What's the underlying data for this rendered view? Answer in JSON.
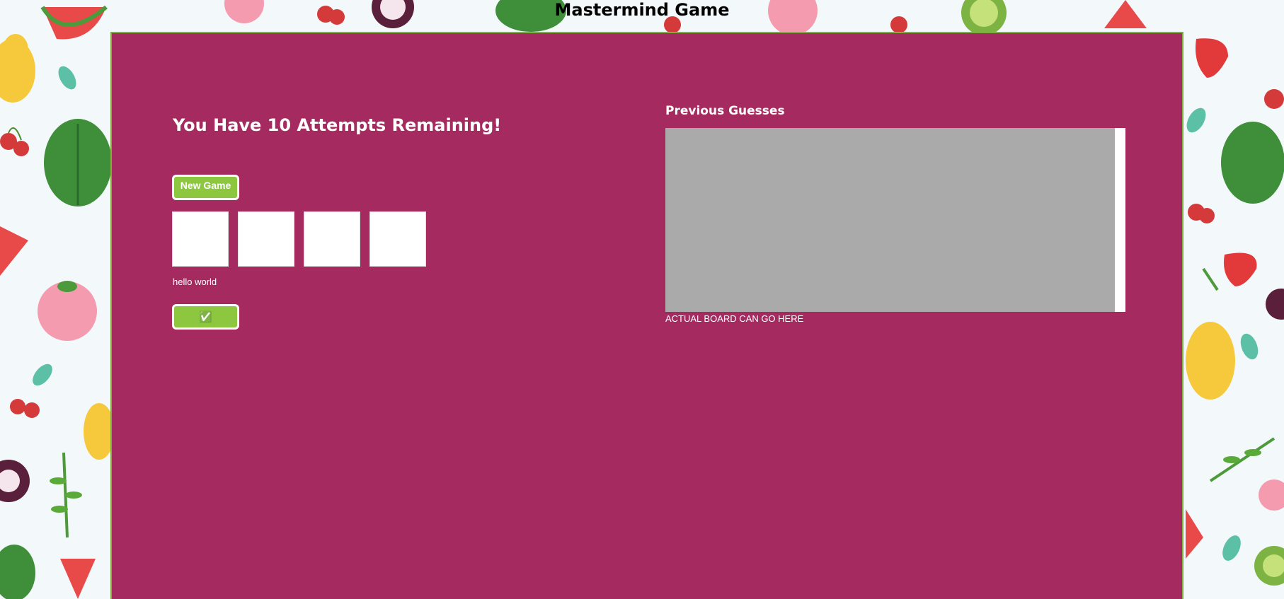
{
  "page": {
    "title": "Mastermind Game"
  },
  "game": {
    "attempts_message": "You Have 10 Attempts Remaining!",
    "new_game_label": "New Game",
    "guess_slots": [
      "",
      "",
      "",
      ""
    ],
    "debug_text": "hello world",
    "submit_label": "✅"
  },
  "history": {
    "title": "Previous Guesses",
    "board_note": "ACTUAL BOARD CAN GO HERE"
  },
  "colors": {
    "panel": "#a52a60",
    "panel_border": "#7bb03a",
    "button": "#8dc63f",
    "history_box": "#aaaaaa"
  }
}
